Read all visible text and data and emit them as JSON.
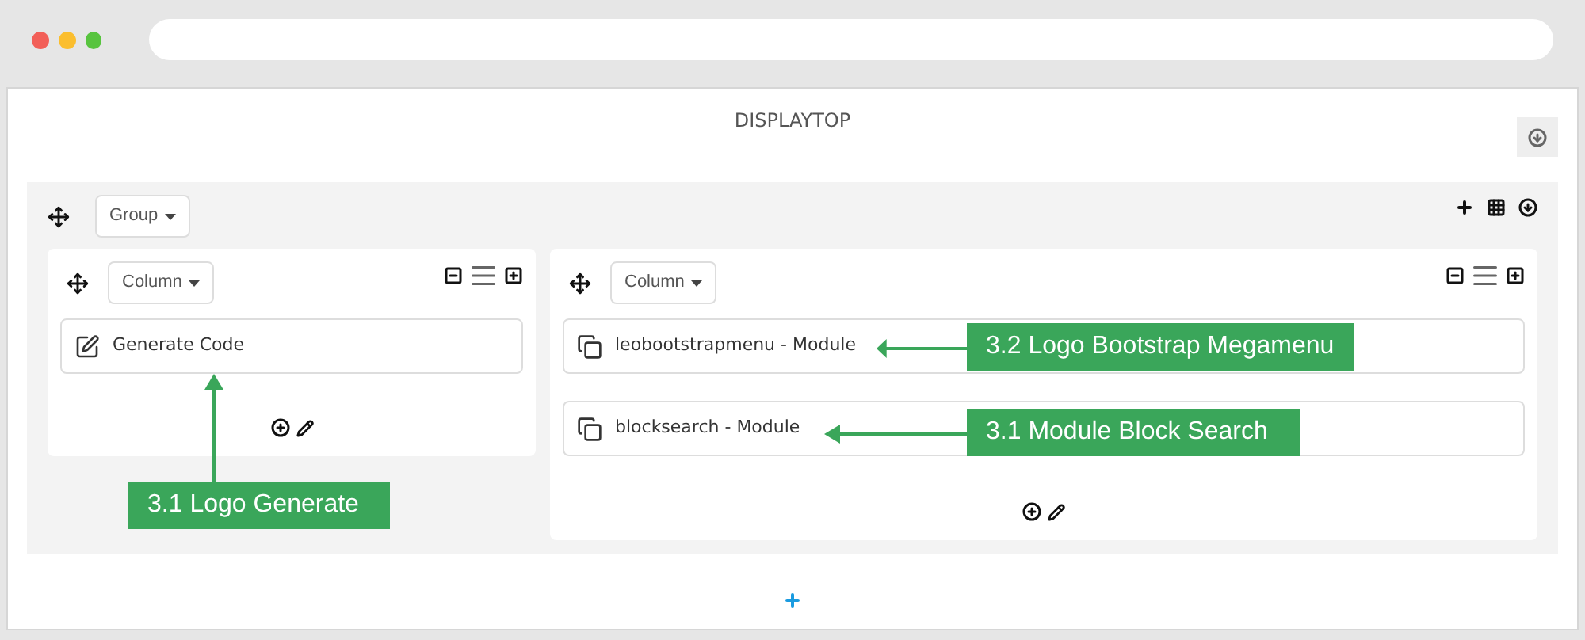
{
  "title": "DISPLAYTOP",
  "group": {
    "label": "Group"
  },
  "columns": [
    {
      "label": "Column",
      "modules": [
        {
          "kind": "code",
          "label": "Generate Code"
        }
      ]
    },
    {
      "label": "Column",
      "modules": [
        {
          "kind": "module",
          "label": "leobootstrapmenu - Module"
        },
        {
          "kind": "module",
          "label": "blocksearch - Module"
        }
      ]
    }
  ],
  "annotations": [
    {
      "label": "3.1 Logo Generate"
    },
    {
      "label": "3.2 Logo Bootstrap Megamenu"
    },
    {
      "label": "3.1 Module Block Search"
    }
  ]
}
